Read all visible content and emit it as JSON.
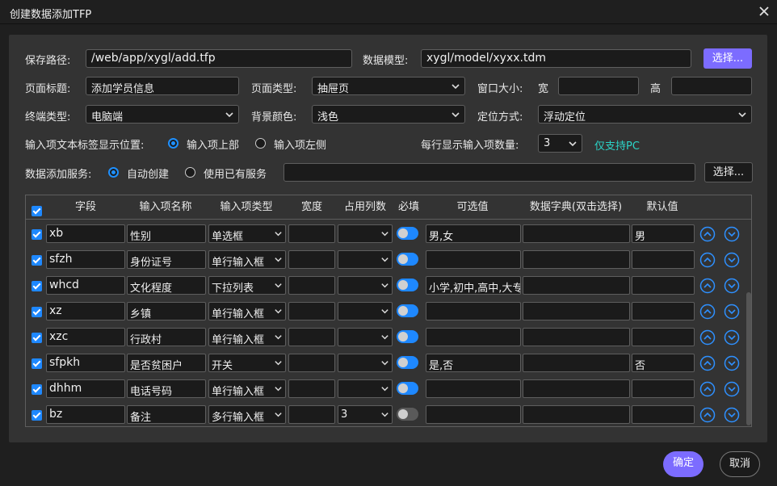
{
  "window": {
    "title": "创建数据添加TFP"
  },
  "form": {
    "save_path_label": "保存路径:",
    "save_path_value": "/web/app/xygl/add.tfp",
    "data_model_label": "数据模型:",
    "data_model_value": "xygl/model/xyxx.tdm",
    "choose_label": "选择...",
    "page_title_label": "页面标题:",
    "page_title_value": "添加学员信息",
    "page_type_label": "页面类型:",
    "page_type_value": "抽屉页",
    "window_size_label": "窗口大小:",
    "width_label": "宽",
    "height_label": "高",
    "terminal_type_label": "终端类型:",
    "terminal_type_value": "电脑端",
    "bg_color_label": "背景颜色:",
    "bg_color_value": "浅色",
    "position_label": "定位方式:",
    "position_value": "浮动定位",
    "label_pos_label": "输入项文本标签显示位置:",
    "label_pos_option_top": "输入项上部",
    "label_pos_option_left": "输入项左侧",
    "per_row_label": "每行显示输入项数量:",
    "per_row_value": "3",
    "pc_only_note": "仅支持PC",
    "service_label": "数据添加服务:",
    "service_option_auto": "自动创建",
    "service_option_existing": "使用已有服务",
    "service_choose_label": "选择..."
  },
  "table": {
    "headers": [
      "字段",
      "输入项名称",
      "输入项类型",
      "宽度",
      "占用列数",
      "必填",
      "可选值",
      "数据字典(双击选择)",
      "默认值"
    ],
    "rows": [
      {
        "field": "xb",
        "name": "性别",
        "type": "单选框",
        "width": "",
        "cols": "",
        "required": true,
        "options": "男,女",
        "dict": "",
        "default": "男"
      },
      {
        "field": "sfzh",
        "name": "身份证号",
        "type": "单行输入框",
        "width": "",
        "cols": "",
        "required": true,
        "options": "",
        "dict": "",
        "default": ""
      },
      {
        "field": "whcd",
        "name": "文化程度",
        "type": "下拉列表",
        "width": "",
        "cols": "",
        "required": true,
        "options": "小学,初中,高中,大专",
        "dict": "",
        "default": ""
      },
      {
        "field": "xz",
        "name": "乡镇",
        "type": "单行输入框",
        "width": "",
        "cols": "",
        "required": true,
        "options": "",
        "dict": "",
        "default": ""
      },
      {
        "field": "xzc",
        "name": "行政村",
        "type": "单行输入框",
        "width": "",
        "cols": "",
        "required": true,
        "options": "",
        "dict": "",
        "default": ""
      },
      {
        "field": "sfpkh",
        "name": "是否贫困户",
        "type": "开关",
        "width": "",
        "cols": "",
        "required": true,
        "options": "是,否",
        "dict": "",
        "default": "否"
      },
      {
        "field": "dhhm",
        "name": "电话号码",
        "type": "单行输入框",
        "width": "",
        "cols": "",
        "required": true,
        "options": "",
        "dict": "",
        "default": ""
      },
      {
        "field": "bz",
        "name": "备注",
        "type": "多行输入框",
        "width": "",
        "cols": "3",
        "required": false,
        "options": "",
        "dict": "",
        "default": ""
      }
    ]
  },
  "footer": {
    "ok_label": "确定",
    "cancel_label": "取消"
  },
  "colors": {
    "accent": "#7c6cff",
    "toggle_on": "#1e88ff",
    "note": "#2bd4c8"
  }
}
